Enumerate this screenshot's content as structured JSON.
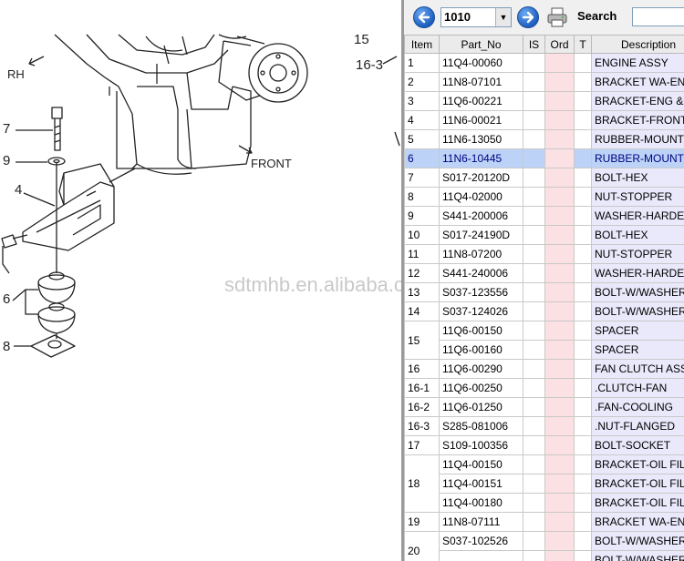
{
  "diagram": {
    "callouts": {
      "rh": "RH",
      "front": "FRONT",
      "c15": "15",
      "c163": "16-3",
      "c7": "7",
      "c9": "9",
      "c4": "4",
      "c6": "6",
      "c8": "8"
    },
    "watermark": "sdtmhb.en.alibaba.com"
  },
  "toolbar": {
    "page_value": "1010",
    "search_label": "Search",
    "search_value": ""
  },
  "table": {
    "headers": {
      "item": "Item",
      "part_no": "Part_No",
      "is": "IS",
      "ord": "Ord",
      "t": "T",
      "desc": "Description"
    },
    "rows": [
      {
        "item": "1",
        "part_no": "11Q4-00060",
        "desc": "ENGINE ASSY"
      },
      {
        "item": "2",
        "part_no": "11N8-07101",
        "desc": "BRACKET WA-EN"
      },
      {
        "item": "3",
        "part_no": "11Q6-00221",
        "desc": "BRACKET-ENG &"
      },
      {
        "item": "4",
        "part_no": "11N6-00021",
        "desc": "BRACKET-FRONT"
      },
      {
        "item": "5",
        "part_no": "11N6-13050",
        "desc": "RUBBER-MOUNT"
      },
      {
        "item": "6",
        "part_no": "11N6-10445",
        "desc": "RUBBER-MOUNT"
      },
      {
        "item": "7",
        "part_no": "S017-20120D",
        "desc": "BOLT-HEX"
      },
      {
        "item": "8",
        "part_no": "11Q4-02000",
        "desc": "NUT-STOPPER"
      },
      {
        "item": "9",
        "part_no": "S441-200006",
        "desc": "WASHER-HARDE"
      },
      {
        "item": "10",
        "part_no": "S017-24190D",
        "desc": "BOLT-HEX"
      },
      {
        "item": "11",
        "part_no": "11N8-07200",
        "desc": "NUT-STOPPER"
      },
      {
        "item": "12",
        "part_no": "S441-240006",
        "desc": "WASHER-HARDE"
      },
      {
        "item": "13",
        "part_no": "S037-123556",
        "desc": "BOLT-W/WASHER"
      },
      {
        "item": "14",
        "part_no": "S037-124026",
        "desc": "BOLT-W/WASHER"
      },
      {
        "item": "15",
        "part_no": "11Q6-00150",
        "desc": "SPACER"
      },
      {
        "item": "",
        "part_no": "11Q6-00160",
        "desc": "SPACER"
      },
      {
        "item": "16",
        "part_no": "11Q6-00290",
        "desc": "FAN CLUTCH ASS"
      },
      {
        "item": "16-1",
        "part_no": "11Q6-00250",
        "desc": ".CLUTCH-FAN"
      },
      {
        "item": "16-2",
        "part_no": "11Q6-01250",
        "desc": ".FAN-COOLING"
      },
      {
        "item": "16-3",
        "part_no": "S285-081006",
        "desc": ".NUT-FLANGED"
      },
      {
        "item": "17",
        "part_no": "S109-100356",
        "desc": "BOLT-SOCKET"
      },
      {
        "item": "18",
        "part_no": "11Q4-00150",
        "desc": "BRACKET-OIL FIL"
      },
      {
        "item": "",
        "part_no": "11Q4-00151",
        "desc": "BRACKET-OIL FIL"
      },
      {
        "item": "",
        "part_no": "11Q4-00180",
        "desc": "BRACKET-OIL FIL"
      },
      {
        "item": "19",
        "part_no": "11N8-07111",
        "desc": "BRACKET WA-EN"
      },
      {
        "item": "20",
        "part_no": "S037-102526",
        "desc": "BOLT-W/WASHER"
      },
      {
        "item": "",
        "part_no": "",
        "desc": "BOLT-W/WASHER"
      }
    ],
    "selected_row": 5
  },
  "colors": {
    "accent": "#1d5fc0",
    "ord_column": "#fbe0e4",
    "selected_row": "#bcd3f7"
  }
}
